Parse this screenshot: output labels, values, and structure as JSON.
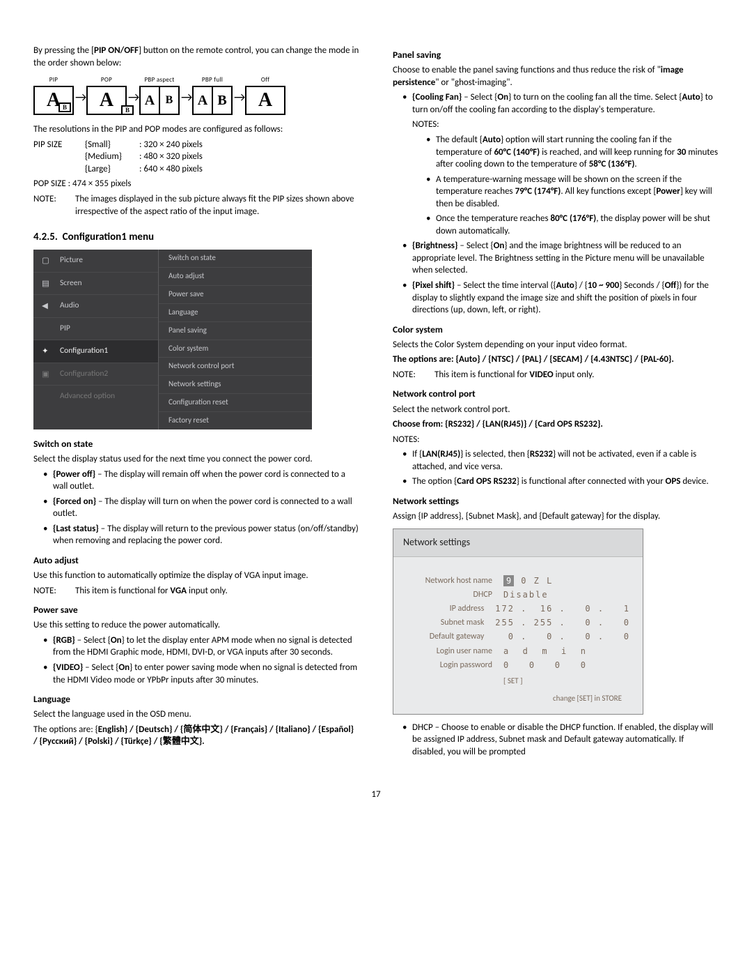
{
  "pageNumber": "17",
  "left": {
    "intro1": "By pressing the [",
    "intro1b": "PIP ON/OFF",
    "intro1c": "] button on the remote control, you can change the mode in the order shown below:",
    "modeLabels": [
      "PIP",
      "POP",
      "PBP aspect",
      "PBP full",
      "Off"
    ],
    "resLine": "The resolutions in the PIP and POP modes are configured as follows:",
    "pip": {
      "label": "PIP SIZE",
      "rows": [
        {
          "size": "{Small}",
          "val": ": 320 × 240 pixels"
        },
        {
          "size": "{Medium}",
          "val": ": 480 × 320 pixels"
        },
        {
          "size": "{Large}",
          "val": ": 640 × 480 pixels"
        }
      ]
    },
    "pop": "POP SIZE : 474 × 355 pixels",
    "noteLabel": "NOTE:",
    "noteBody": "The images displayed in the sub picture always fit the PIP sizes shown above irrespective of the aspect ratio of the input image.",
    "sectionNum": "4.2.5.",
    "sectionTitle": "Configuration1 menu",
    "osdLeft": [
      "Picture",
      "Screen",
      "Audio",
      "PIP",
      "Configuration1",
      "Configuration2",
      "Advanced option"
    ],
    "osdRight": [
      "Switch on state",
      "Auto adjust",
      "Power save",
      "Language",
      "Panel saving",
      "Color system",
      "Network control port",
      "Network settings",
      "Configuration reset",
      "Factory reset"
    ],
    "switchOn": {
      "h": "Switch on state",
      "p": "Select the display status used for the next time you connect the power cord.",
      "items": [
        {
          "b": "{Power off}",
          "t": " – The display will remain off when the power cord is connected to a wall outlet."
        },
        {
          "b": "{Forced on}",
          "t": " – The display will turn on when the power cord is connected to a wall outlet."
        },
        {
          "b": "{Last status}",
          "t": " – The display will return to the previous power status (on/off/standby) when removing and replacing the power cord."
        }
      ]
    },
    "autoAdjust": {
      "h": "Auto adjust",
      "p": "Use this function to automatically optimize the display of VGA input image.",
      "noteLabel": "NOTE:",
      "note1": "This item is functional for ",
      "noteB": "VGA",
      "note2": " input only."
    },
    "powerSave": {
      "h": "Power save",
      "p": "Use this setting to reduce the power automatically.",
      "items": [
        {
          "b": "{RGB}",
          "t1": " – Select {",
          "b2": "On",
          "t2": "} to let the display enter APM mode when no signal is detected from the HDMI Graphic mode, HDMI, DVI-D, or VGA inputs after 30 seconds."
        },
        {
          "b": "{VIDEO}",
          "t1": " – Select {",
          "b2": "On",
          "t2": "} to enter power saving mode when no signal is detected from the HDMI Video mode or YPbPr inputs after 30 minutes."
        }
      ]
    },
    "language": {
      "h": "Language",
      "p": "Select the language used in the OSD menu.",
      "opts1": "The options are: {",
      "list": "English} / {Deutsch} / {简体中文} / {Français} / {Italiano} / {Español} / {Русский} / {Polski} / {Türkçe} / {繁體中文}."
    }
  },
  "right": {
    "panelSaving": {
      "h": "Panel saving",
      "p1a": "Choose to enable the panel saving functions and thus reduce the risk of \"",
      "p1b": "image persistence",
      "p1c": "\" or \"ghost-imaging\".",
      "fan": {
        "lead_b": "{Cooling Fan}",
        "lead_t1": " – Select {",
        "lead_b2": "On",
        "lead_t2": "} to turn on the cooling fan all the time. Select {",
        "lead_b3": "Auto",
        "lead_t3": "} to turn on/off the cooling fan according to the display's temperature.",
        "notesLabel": "NOTES:",
        "n1a": "The default {",
        "n1b": "Auto",
        "n1c": "} option will start running the cooling fan if the temperature of ",
        "n1d": "60°C (140°F)",
        "n1e": " is reached, and will keep running for ",
        "n1f": "30",
        "n1g": " minutes after cooling down to the temperature of ",
        "n1h": "58°C (136°F)",
        "n1i": ".",
        "n2a": "A temperature-warning message will be shown on the screen if the temperature reaches ",
        "n2b": "79°C (174°F)",
        "n2c": ". All key functions except [",
        "n2d": "Power",
        "n2e": "] key will then be disabled.",
        "n3a": "Once the temperature reaches ",
        "n3b": "80°C (176°F)",
        "n3c": ", the display power will be shut down automatically."
      },
      "brightness": {
        "b": "{Brightness}",
        "t1": " – Select {",
        "b2": "On",
        "t2": "} and the image brightness will be reduced to an appropriate level. The Brightness setting in the Picture menu will be unavailable when selected."
      },
      "pixel": {
        "b": "{Pixel shift}",
        "t1": " – Select the time interval ({",
        "b2": "Auto",
        "t2": "} / {",
        "b3": "10 ~ 900",
        "t3": "} Seconds / {",
        "b4": "Off",
        "t4": "}) for the display to slightly expand the image size and shift the position of pixels in four directions (up, down, left, or right)."
      }
    },
    "colorSystem": {
      "h": "Color system",
      "p": "Selects the Color System depending on your input video format.",
      "opts": "The options are: {Auto} / {NTSC} / {PAL} / {SECAM} / {4.43NTSC} / {PAL-60}.",
      "noteLabel": "NOTE:",
      "note1": "This item is functional for ",
      "noteB": "VIDEO",
      "note2": " input only."
    },
    "netPort": {
      "h": "Network control port",
      "p1": "Select the network control port.",
      "p2": "Choose from: {RS232} / {LAN(RJ45)} / {Card OPS RS232}.",
      "notesLabel": "NOTES:",
      "n1a": "If {",
      "n1b": "LAN(RJ45)",
      "n1c": "} is selected, then {",
      "n1d": "RS232",
      "n1e": "} will not be activated, even if a cable is attached, and vice versa.",
      "n2a": "The option {",
      "n2b": "Card OPS RS232",
      "n2c": "} is functional after connected with your ",
      "n2d": "OPS",
      "n2e": " device."
    },
    "netSettings": {
      "h": "Network settings",
      "p1": "Assign {IP address}, {Subnet Mask}, and {Default gateway} for the display.",
      "boxTitle": "Network settings",
      "rows": {
        "hostLabel": "Network host name",
        "hostVal": "0   Z   L",
        "dhcpLabel": "DHCP",
        "dhcpVal": "Disable",
        "ipLabel": "IP address",
        "ipVal": "172 .  16 .   0 .   1",
        "maskLabel": "Subnet mask",
        "maskVal": "255 . 255 .   0 .   0",
        "gwLabel": "Default gateway",
        "gwVal": "  0 .   0 .   0 .   0",
        "userLabel": "Login user name",
        "userVal": "a  d  m  i  n",
        "pwLabel": "Login password",
        "pwVal": "0   0   0   0"
      },
      "setBtn": "[ SET ]",
      "footer": "change [SET] in STORE",
      "dhcpNote": "DHCP – Choose to enable or disable the DHCP function. If enabled, the display will be assigned IP address, Subnet mask and Default gateway automatically. If disabled, you will be prompted"
    }
  }
}
